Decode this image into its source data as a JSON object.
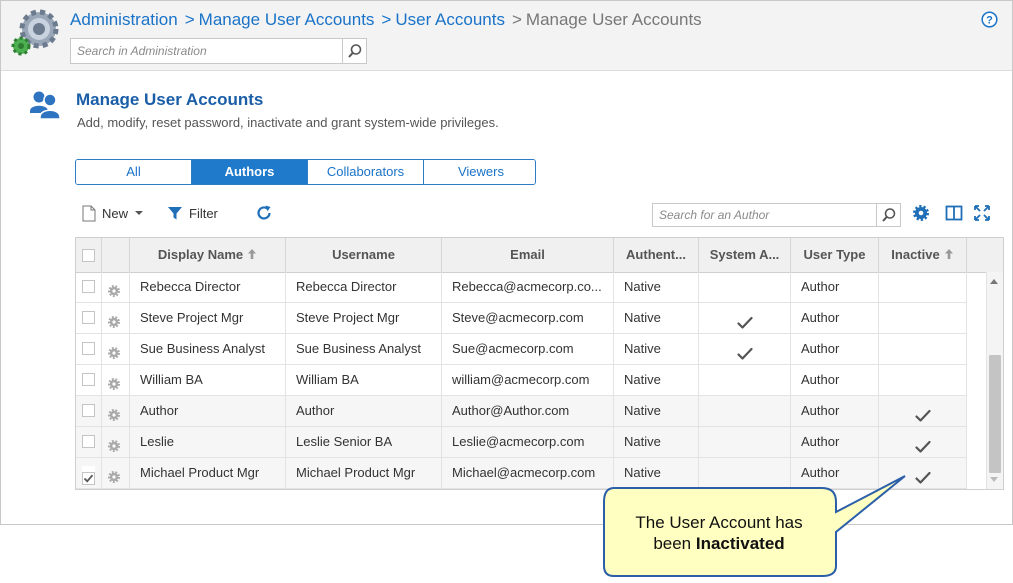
{
  "breadcrumb": {
    "items": [
      "Administration",
      "Manage User Accounts",
      "User Accounts"
    ],
    "current": "Manage User Accounts"
  },
  "admin_search": {
    "placeholder": "Search in Administration"
  },
  "page": {
    "title": "Manage User Accounts",
    "subtitle": "Add, modify, reset password, inactivate and grant system-wide privileges."
  },
  "tabs": [
    {
      "label": "All",
      "active": false
    },
    {
      "label": "Authors",
      "active": true
    },
    {
      "label": "Collaborators",
      "active": false
    },
    {
      "label": "Viewers",
      "active": false
    }
  ],
  "toolbar": {
    "new_label": "New",
    "filter_label": "Filter",
    "author_search_placeholder": "Search for an Author"
  },
  "grid": {
    "columns": [
      "Display Name",
      "Username",
      "Email",
      "Authent...",
      "System A...",
      "User Type",
      "Inactive"
    ],
    "rows": [
      {
        "display_name": "Rebecca Director",
        "username": "Rebecca Director",
        "email": "Rebecca@acmecorp.co...",
        "auth": "Native",
        "system_admin": false,
        "user_type": "Author",
        "inactive": false,
        "selected": false
      },
      {
        "display_name": "Steve Project Mgr",
        "username": "Steve Project Mgr",
        "email": "Steve@acmecorp.com",
        "auth": "Native",
        "system_admin": true,
        "user_type": "Author",
        "inactive": false,
        "selected": false
      },
      {
        "display_name": "Sue Business Analyst",
        "username": "Sue Business Analyst",
        "email": "Sue@acmecorp.com",
        "auth": "Native",
        "system_admin": true,
        "user_type": "Author",
        "inactive": false,
        "selected": false
      },
      {
        "display_name": "William BA",
        "username": "William BA",
        "email": "william@acmecorp.com",
        "auth": "Native",
        "system_admin": false,
        "user_type": "Author",
        "inactive": false,
        "selected": false
      },
      {
        "display_name": "Author",
        "username": "Author",
        "email": "Author@Author.com",
        "auth": "Native",
        "system_admin": false,
        "user_type": "Author",
        "inactive": true,
        "selected": false
      },
      {
        "display_name": "Leslie",
        "username": "Leslie Senior BA",
        "email": "Leslie@acmecorp.com",
        "auth": "Native",
        "system_admin": false,
        "user_type": "Author",
        "inactive": true,
        "selected": false
      },
      {
        "display_name": "Michael Product Mgr",
        "username": "Michael Product Mgr",
        "email": "Michael@acmecorp.com",
        "auth": "Native",
        "system_admin": false,
        "user_type": "Author",
        "inactive": true,
        "selected": true
      }
    ]
  },
  "callout": {
    "line1": "The User Account has",
    "line2_prefix": "been ",
    "line2_bold": "Inactivated"
  },
  "colors": {
    "link": "#1a73c8",
    "active_tab": "#1f7acb",
    "title": "#1b5ea8",
    "callout_fill": "#ffffc2",
    "callout_border": "#2b5fa8"
  },
  "icons": [
    "gear-app-icon",
    "help-icon",
    "search-icon",
    "users-icon",
    "new-document-icon",
    "filter-icon",
    "refresh-icon",
    "settings-gear-icon",
    "columns-icon",
    "fullscreen-icon",
    "row-gear-icon",
    "checkmark-icon",
    "sort-up-icon"
  ]
}
